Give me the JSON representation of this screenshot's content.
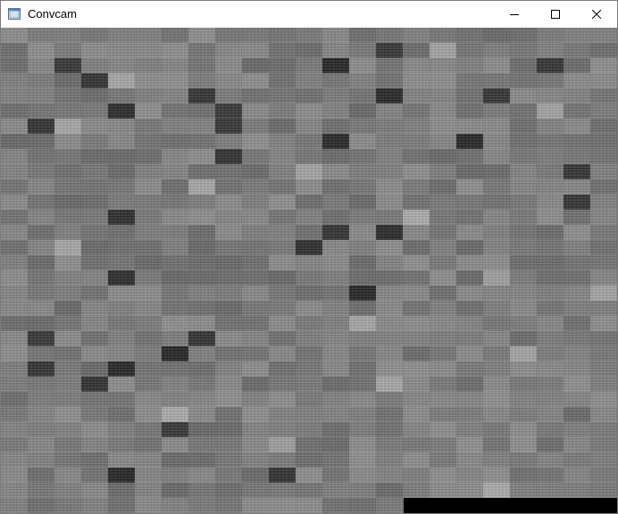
{
  "window": {
    "title": "Convcam",
    "controls": {
      "minimize_icon": "minimize-icon",
      "maximize_icon": "maximize-icon",
      "close_icon": "close-icon"
    }
  },
  "feature_map": {
    "columns": 23,
    "rows": 32,
    "base_gray": "#777777",
    "dark_tiles": [
      [
        2,
        2
      ],
      [
        3,
        3
      ],
      [
        5,
        4
      ],
      [
        5,
        8
      ],
      [
        4,
        7
      ],
      [
        6,
        8
      ],
      [
        7,
        12
      ],
      [
        4,
        14
      ],
      [
        13,
        12
      ],
      [
        11,
        21
      ],
      [
        12,
        4
      ],
      [
        13,
        14
      ],
      [
        16,
        4
      ],
      [
        22,
        1
      ],
      [
        22,
        4
      ],
      [
        29,
        4
      ],
      [
        23,
        3
      ],
      [
        26,
        6
      ],
      [
        14,
        11
      ],
      [
        17,
        13
      ],
      [
        9,
        21
      ],
      [
        20,
        1
      ],
      [
        20,
        7
      ],
      [
        21,
        6
      ],
      [
        2,
        12
      ],
      [
        2,
        20
      ],
      [
        4,
        18
      ],
      [
        1,
        14
      ],
      [
        6,
        1
      ],
      [
        7,
        17
      ],
      [
        8,
        8
      ],
      [
        29,
        10
      ]
    ],
    "light_tiles": [
      [
        3,
        4
      ],
      [
        6,
        2
      ],
      [
        10,
        7
      ],
      [
        12,
        15
      ],
      [
        14,
        2
      ],
      [
        16,
        18
      ],
      [
        19,
        13
      ],
      [
        21,
        19
      ],
      [
        23,
        14
      ],
      [
        25,
        6
      ],
      [
        27,
        10
      ],
      [
        30,
        18
      ],
      [
        9,
        11
      ],
      [
        5,
        20
      ],
      [
        17,
        22
      ],
      [
        1,
        16
      ]
    ]
  },
  "colors": {
    "titlebar_bg": "#ffffff",
    "border": "#7a7a7a",
    "idle_region": "#000000"
  }
}
